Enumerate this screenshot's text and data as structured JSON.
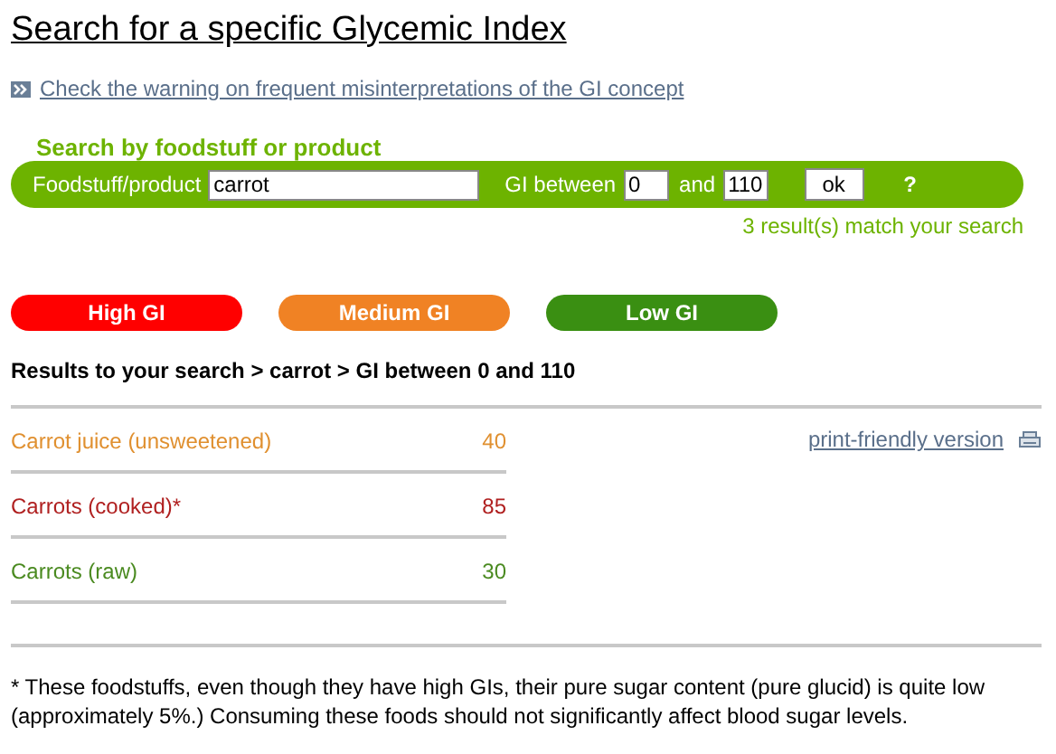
{
  "title": "Search for a specific Glycemic Index",
  "warning_link": "Check the warning on frequent misinterpretations of the GI concept",
  "search": {
    "heading": "Search by foodstuff or product",
    "food_label": "Foodstuff/product",
    "food_value": "carrot",
    "gi_label": "GI between",
    "gi_min": "0",
    "and_label": "and",
    "gi_max": "110",
    "ok_button": "ok",
    "help": "?",
    "result_count": "3 result(s) match your search"
  },
  "legend": [
    {
      "label": "High GI",
      "color": "#ff0000"
    },
    {
      "label": "Medium GI",
      "color": "#f08224"
    },
    {
      "label": "Low GI",
      "color": "#3a8f12"
    }
  ],
  "results_heading": "Results to your search > carrot > GI between 0 and 110",
  "results": [
    {
      "name": "Carrot juice (unsweetened)",
      "gi": "40",
      "color": "#e09030"
    },
    {
      "name": "Carrots (cooked)*",
      "gi": "85",
      "color": "#b02020"
    },
    {
      "name": "Carrots (raw)",
      "gi": "30",
      "color": "#4a8a20"
    }
  ],
  "print_link": "print-friendly version",
  "footnote": "* These foodstuffs, even though they have high GIs, their pure sugar content (pure glucid) is quite low (approximately 5%.) Consuming these foods should not significantly affect blood sugar levels."
}
